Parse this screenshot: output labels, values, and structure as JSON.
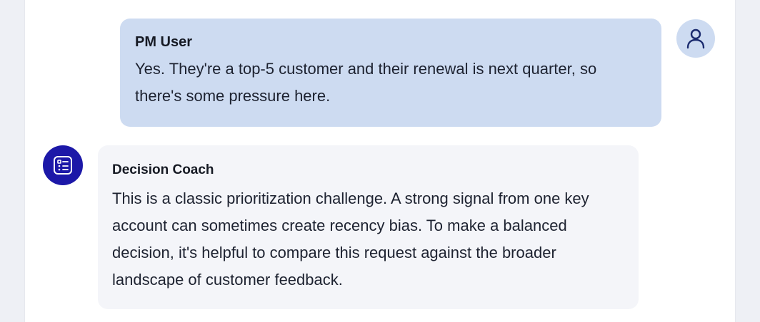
{
  "conversation": {
    "messages": [
      {
        "role": "user",
        "sender": "PM User",
        "avatar_icon": "user-icon",
        "text": "Yes. They're a top-5 customer and their renewal is next quarter, so there's some pressure here."
      },
      {
        "role": "assistant",
        "sender": "Decision Coach",
        "avatar_icon": "decision-checklist-icon",
        "text": "This is a classic prioritization challenge. A strong signal from one key account can sometimes create recency bias. To make a balanced decision, it's helpful to compare this request against the broader landscape of customer feedback."
      }
    ]
  },
  "colors": {
    "user_bubble": "#cddbf1",
    "coach_bubble": "#f4f5f9",
    "coach_avatar": "#1c18a8",
    "user_icon_stroke": "#1a2a6e"
  }
}
